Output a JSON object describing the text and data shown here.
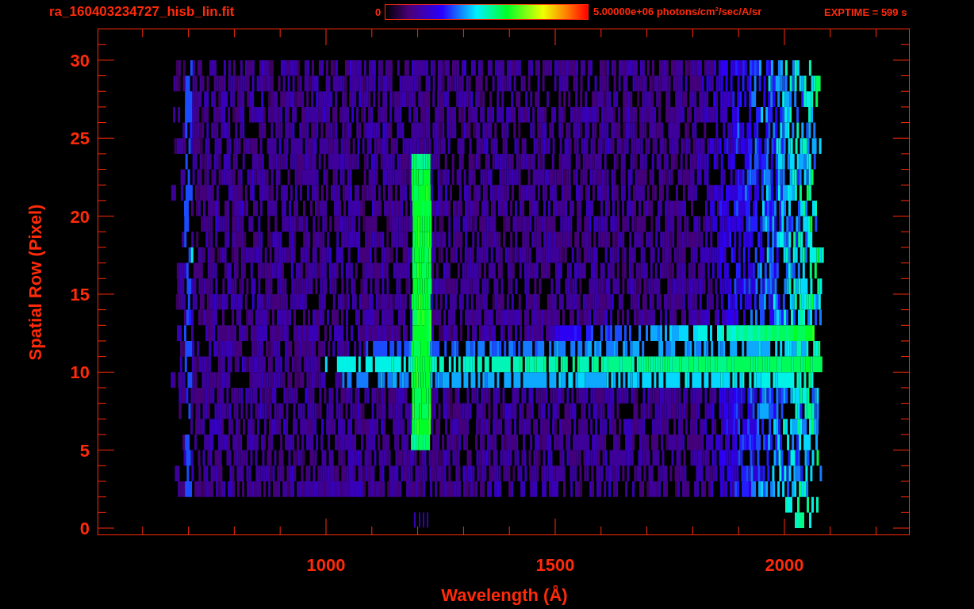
{
  "header": {
    "title": "ra_160403234727_hisb_lin.fit",
    "colorbar": {
      "min_label": "0",
      "max_label": "5.00000e+06 photons/cm$^{2}$/sec/A/sr"
    },
    "exposure": "EXPTIME = 599 s"
  },
  "plot": {
    "y_axis": {
      "title": "Spatial Row (Pixel)",
      "ticks": [
        "30",
        "25",
        "20",
        "15",
        "10",
        "5",
        "0"
      ]
    },
    "x_axis": {
      "title": "Wavelength (Å)",
      "ticks": [
        "1000",
        "1500",
        "2000"
      ]
    }
  }
}
